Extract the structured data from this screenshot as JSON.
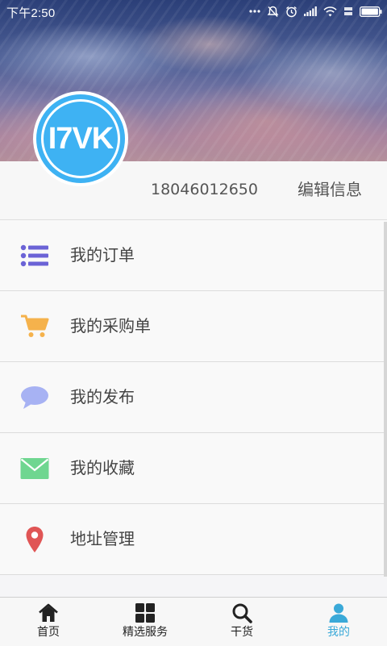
{
  "status_bar": {
    "time": "下午2:50",
    "icons": [
      "more-dots-icon",
      "mute-icon",
      "alarm-icon",
      "signal-icon",
      "wifi-icon",
      "network-type-icon",
      "battery-icon"
    ]
  },
  "profile": {
    "avatar_text": "I7VK",
    "phone": "18046012650",
    "edit_label": "编辑信息"
  },
  "menu": {
    "items": [
      {
        "label": "我的订单",
        "icon": "list-icon",
        "color": "#6b63d6"
      },
      {
        "label": "我的采购单",
        "icon": "cart-icon",
        "color": "#f5b24c"
      },
      {
        "label": "我的发布",
        "icon": "chat-bubble-icon",
        "color": "#a7b2f3"
      },
      {
        "label": "我的收藏",
        "icon": "envelope-icon",
        "color": "#6fd690"
      },
      {
        "label": "地址管理",
        "icon": "location-pin-icon",
        "color": "#e05555"
      }
    ]
  },
  "tabbar": {
    "tabs": [
      {
        "label": "首页",
        "icon": "home-icon",
        "active": false
      },
      {
        "label": "精选服务",
        "icon": "grid-icon",
        "active": false
      },
      {
        "label": "干货",
        "icon": "search-icon",
        "active": false
      },
      {
        "label": "我的",
        "icon": "user-icon",
        "active": true
      }
    ],
    "active_color": "#3aa9d8"
  },
  "colors": {
    "avatar_bg": "#3eb2f3"
  }
}
